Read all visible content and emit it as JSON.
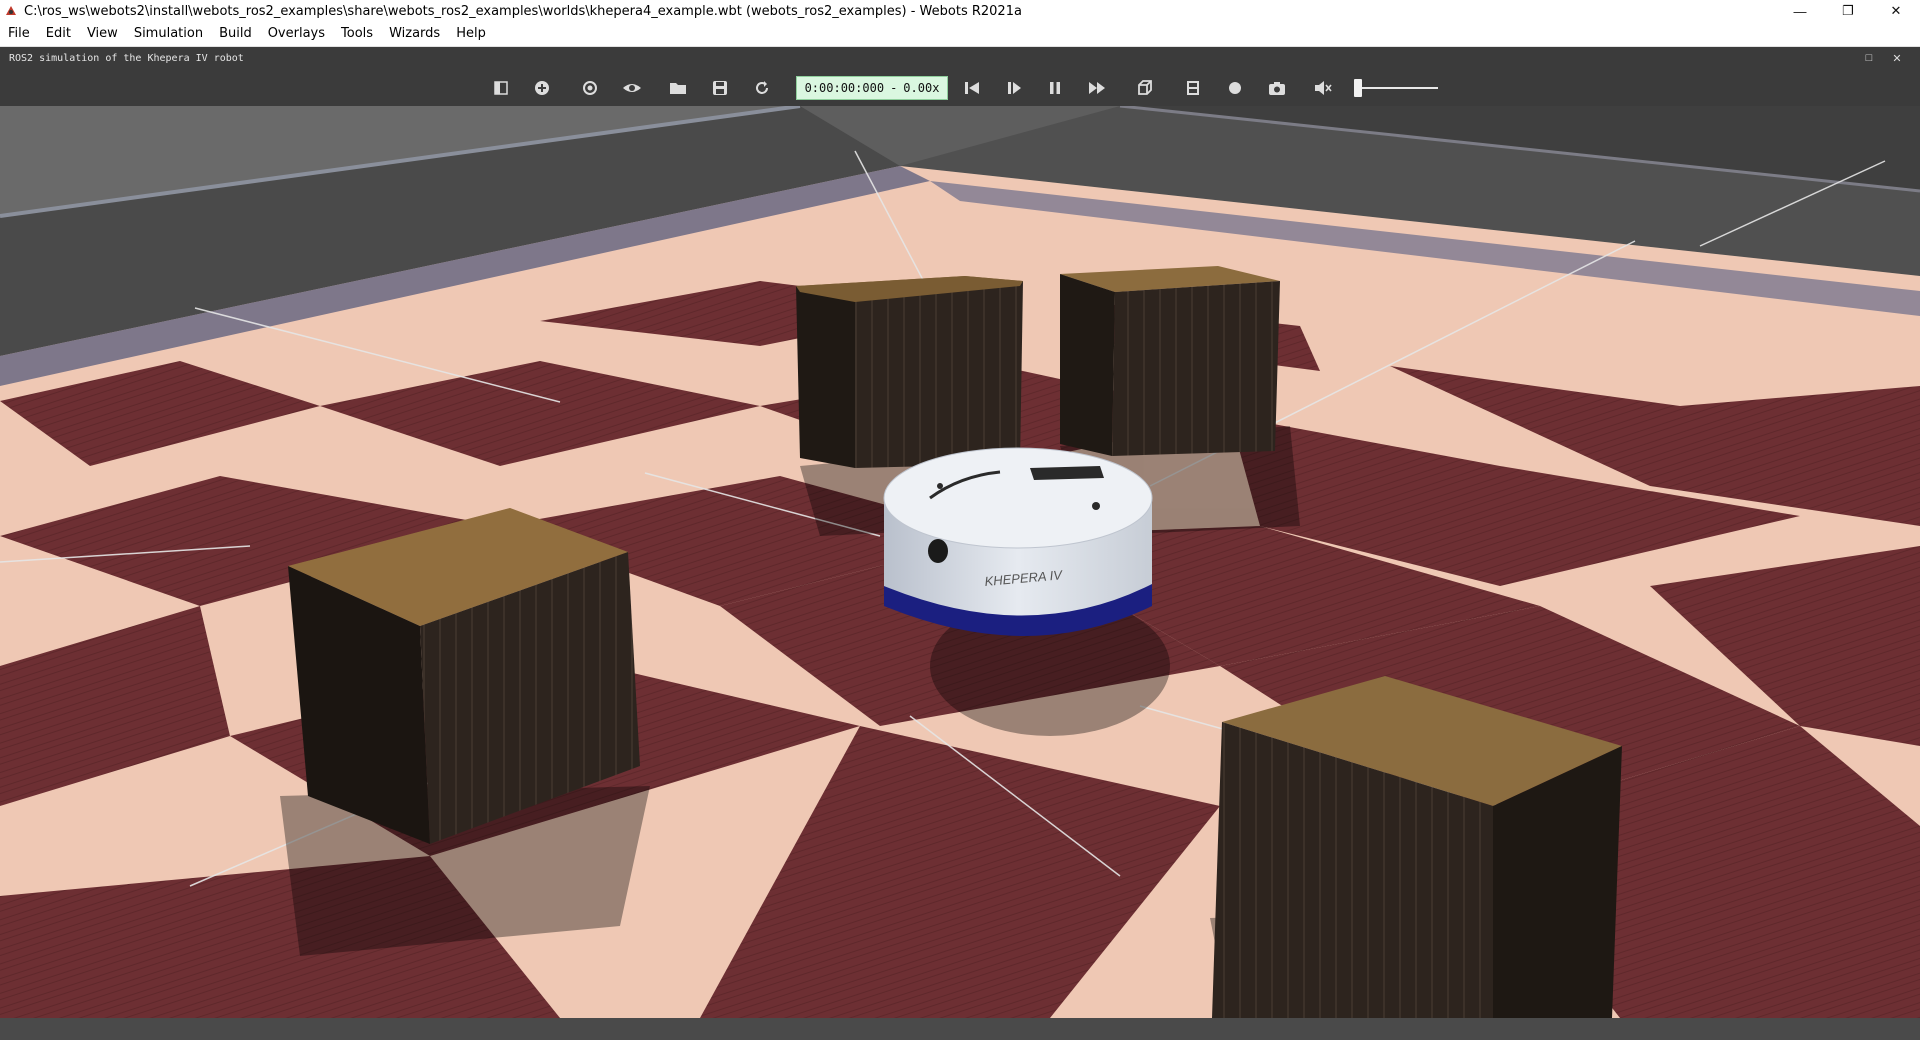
{
  "window": {
    "title": "C:\\ros_ws\\webots2\\install\\webots_ros2_examples\\share\\webots_ros2_examples\\worlds\\khepera4_example.wbt (webots_ros2_examples) - Webots R2021a",
    "controls": {
      "minimize": "—",
      "restore": "❐",
      "close": "✕"
    }
  },
  "menu": [
    "File",
    "Edit",
    "View",
    "Simulation",
    "Build",
    "Overlays",
    "Tools",
    "Wizards",
    "Help"
  ],
  "dock": {
    "title": "ROS2 simulation of the Khepera IV robot",
    "restore_glyph": "□",
    "close_glyph": "✕"
  },
  "toolbar": {
    "time": "0:00:00:000",
    "separator": "-",
    "speed": "0.00x",
    "icons": [
      "scene-tree-toggle-icon",
      "add-node-icon",
      "follow-view-icon",
      "view-icon",
      "open-world-icon",
      "save-world-icon",
      "reload-world-icon",
      "reset-simulation-icon",
      "step-icon",
      "pause-icon",
      "fast-forward-icon",
      "projection-icon",
      "record-movie-icon",
      "record-animation-icon",
      "screenshot-icon",
      "mute-icon"
    ]
  },
  "scene": {
    "robot_label": "KHEPERA IV",
    "colors": {
      "floor_light": "#edc6b2",
      "floor_dark": "#6c2e32",
      "wall": "#4c4c4c",
      "crate_top": "#8a6a3c",
      "crate_side": "#2c231d",
      "robot_body": "#d8dde6",
      "robot_band": "#1b1f80"
    }
  }
}
